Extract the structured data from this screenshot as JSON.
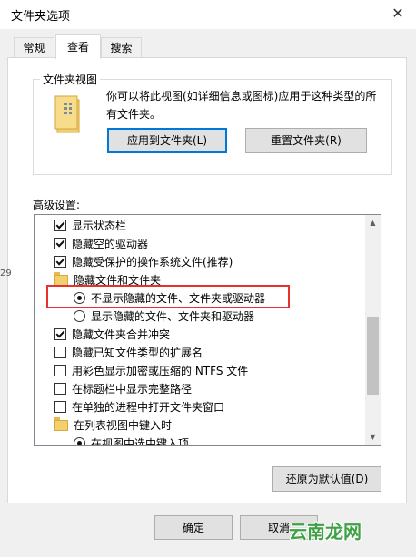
{
  "window": {
    "title": "文件夹选项",
    "close_glyph": "✕"
  },
  "tabs": [
    {
      "label": "常规",
      "active": false
    },
    {
      "label": "查看",
      "active": true
    },
    {
      "label": "搜索",
      "active": false
    }
  ],
  "folder_view": {
    "group_label": "文件夹视图",
    "description": "你可以将此视图(如详细信息或图标)应用于这种类型的所有文件夹。",
    "apply_button": "应用到文件夹(L)",
    "reset_button": "重置文件夹(R)"
  },
  "advanced": {
    "label": "高级设置:",
    "items": [
      {
        "kind": "checkbox",
        "checked": true,
        "label": "显示状态栏"
      },
      {
        "kind": "checkbox",
        "checked": true,
        "label": "隐藏空的驱动器"
      },
      {
        "kind": "checkbox",
        "checked": true,
        "label": "隐藏受保护的操作系统文件(推荐)"
      },
      {
        "kind": "folder",
        "checked": false,
        "label": "隐藏文件和文件夹"
      },
      {
        "kind": "radio",
        "checked": true,
        "label": "不显示隐藏的文件、文件夹或驱动器"
      },
      {
        "kind": "radio",
        "checked": false,
        "label": "显示隐藏的文件、文件夹和驱动器"
      },
      {
        "kind": "checkbox",
        "checked": true,
        "label": "隐藏文件夹合并冲突"
      },
      {
        "kind": "checkbox",
        "checked": false,
        "label": "隐藏已知文件类型的扩展名"
      },
      {
        "kind": "checkbox",
        "checked": false,
        "label": "用彩色显示加密或压缩的 NTFS 文件"
      },
      {
        "kind": "checkbox",
        "checked": false,
        "label": "在标题栏中显示完整路径"
      },
      {
        "kind": "checkbox",
        "checked": false,
        "label": "在单独的进程中打开文件夹窗口"
      },
      {
        "kind": "folder",
        "checked": false,
        "label": "在列表视图中键入时"
      },
      {
        "kind": "radio",
        "checked": true,
        "label": "在视图中选中键入项"
      }
    ],
    "restore_button": "还原为默认值(D)"
  },
  "footer": {
    "ok_button": "确定",
    "cancel_button": "取消"
  },
  "side_fragment": "29",
  "watermark": "云南龙网",
  "colors": {
    "highlight": "#e5322e",
    "focus": "#0078d7",
    "watermark": "#3fa046"
  }
}
